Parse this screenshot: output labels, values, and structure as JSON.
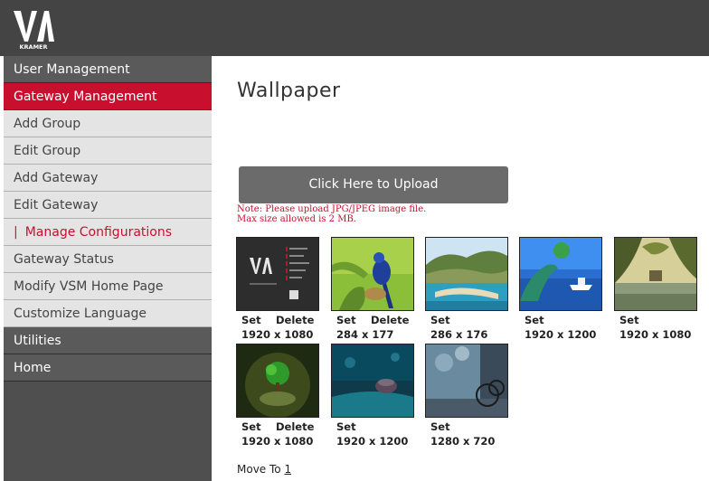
{
  "brand": {
    "logo_text": "VIA",
    "logo_sub": "KRAMER"
  },
  "sidebar": {
    "items": [
      {
        "label": "User Management"
      },
      {
        "label": "Gateway Management"
      },
      {
        "label": "Add Group"
      },
      {
        "label": "Edit Group"
      },
      {
        "label": "Add Gateway"
      },
      {
        "label": "Edit Gateway"
      },
      {
        "label": "Manage Configurations",
        "marker": "|"
      },
      {
        "label": "Gateway Status"
      },
      {
        "label": "Modify VSM Home Page"
      },
      {
        "label": "Customize Language"
      },
      {
        "label": "Utilities"
      },
      {
        "label": "Home"
      }
    ]
  },
  "main": {
    "title": "Wallpaper",
    "upload_label": "Click Here to Upload",
    "note_line1": "Note: Please upload JPG/JPEG image file.",
    "note_line2": "Max size allowed is 2 MB.",
    "wallpapers": [
      {
        "set": "Set",
        "delete": "Delete",
        "resolution": "1920 x 1080",
        "image": "via-screen-thumbnail"
      },
      {
        "set": "Set",
        "delete": "Delete",
        "resolution": "284 x 177",
        "image": "blue-bird-thumbnail"
      },
      {
        "set": "Set",
        "resolution": "286 x 176",
        "image": "beach-cove-thumbnail"
      },
      {
        "set": "Set",
        "resolution": "1920 x 1200",
        "image": "ocean-boat-thumbnail"
      },
      {
        "set": "Set",
        "resolution": "1920 x 1080",
        "image": "temple-lake-thumbnail"
      },
      {
        "set": "Set",
        "delete": "Delete",
        "resolution": "1920 x 1080",
        "image": "green-tree-globe-thumbnail"
      },
      {
        "set": "Set",
        "resolution": "1920 x 1200",
        "image": "teal-macro-thumbnail"
      },
      {
        "set": "Set",
        "resolution": "1280 x 720",
        "image": "bicycle-street-thumbnail"
      }
    ],
    "move_to_label": "Move To",
    "move_to_page": "1"
  },
  "colors": {
    "accent": "#c8102e",
    "topbar": "#444444",
    "sidebar": "#4f4f4f",
    "button": "#6b6b6b"
  }
}
